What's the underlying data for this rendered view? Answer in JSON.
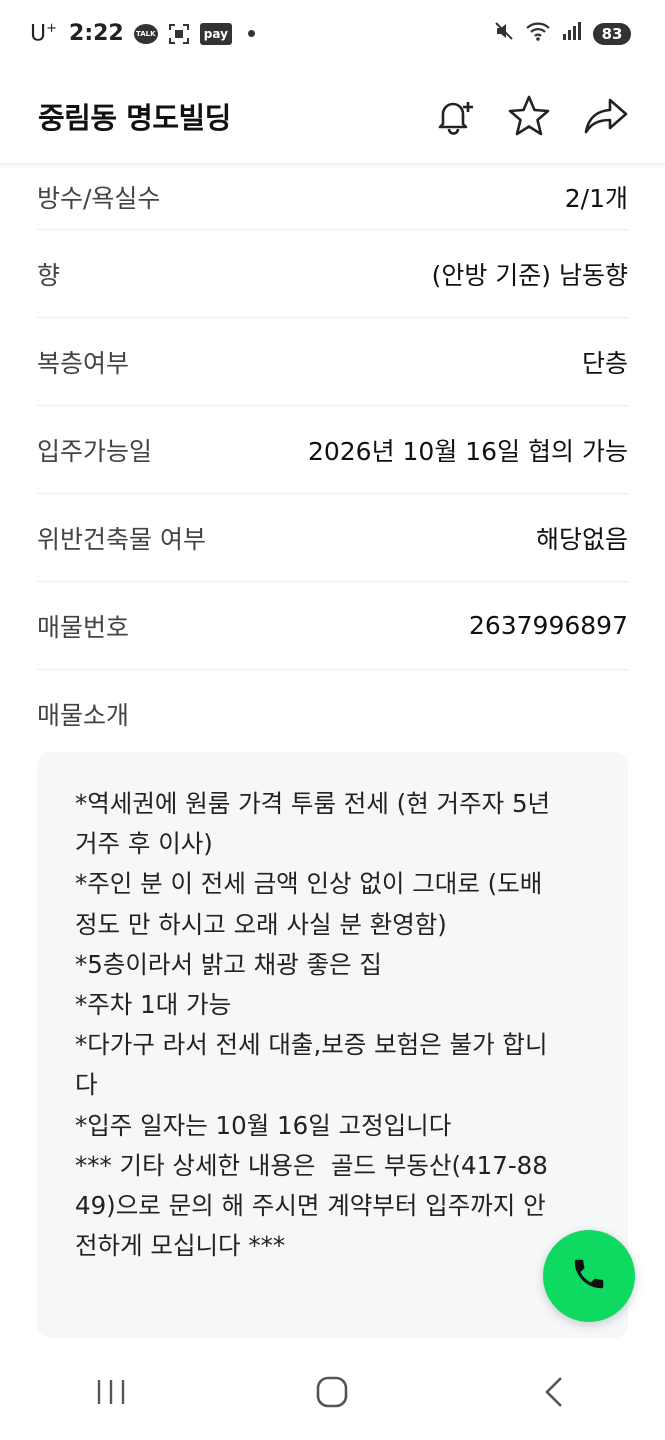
{
  "status_bar": {
    "carrier": "U",
    "carrier_sup": "+",
    "time": "2:22",
    "talk_badge": "TALK",
    "pay_badge": "pay",
    "battery": "83",
    "icons": [
      "kakaotalk-icon",
      "scan-icon",
      "pay-icon",
      "dot-icon",
      "mute-icon",
      "wifi-icon",
      "signal-icon",
      "battery-icon"
    ]
  },
  "header": {
    "title": "중림동 명도빌딩",
    "icons": [
      "bell-plus-icon",
      "star-icon",
      "share-icon"
    ]
  },
  "details": [
    {
      "label": "방수/욕실수",
      "value": "2/1개"
    },
    {
      "label": "향",
      "value": "(안방 기준) 남동향"
    },
    {
      "label": "복층여부",
      "value": "단층"
    },
    {
      "label": "입주가능일",
      "value": "2026년 10월 16일 협의 가능"
    },
    {
      "label": "위반건축물 여부",
      "value": "해당없음"
    },
    {
      "label": "매물번호",
      "value": "2637996897"
    }
  ],
  "intro": {
    "label": "매물소개",
    "lines": [
      "*역세권에 원룸 가격 투룸 전세 (현 거주자 5년",
      "거주 후 이사)",
      "*주인 분 이 전세 금액 인상 없이 그대로 (도배",
      "정도 만 하시고 오래 사실 분 환영함)",
      "*5층이라서 밝고 채광 좋은 집",
      "*주차 1대 가능",
      "*다가구 라서 전세 대출,보증 보험은 불가 합니",
      "다",
      "*입주 일자는 10월 16일 고정입니다",
      "",
      "*** 기타 상세한 내용은  골드 부동산(417-88",
      "49)으로 문의 해 주시면 계약부터 입주까지 안",
      "전하게 모십니다 ***"
    ]
  },
  "fab": {
    "icon": "phone-icon",
    "color": "#0ed960"
  },
  "nav": {
    "icons": [
      "recent-apps-icon",
      "home-icon",
      "back-icon"
    ]
  },
  "colors": {
    "accent": "#0ed960",
    "panel": "#f6f7f9",
    "divider": "#ececec"
  }
}
